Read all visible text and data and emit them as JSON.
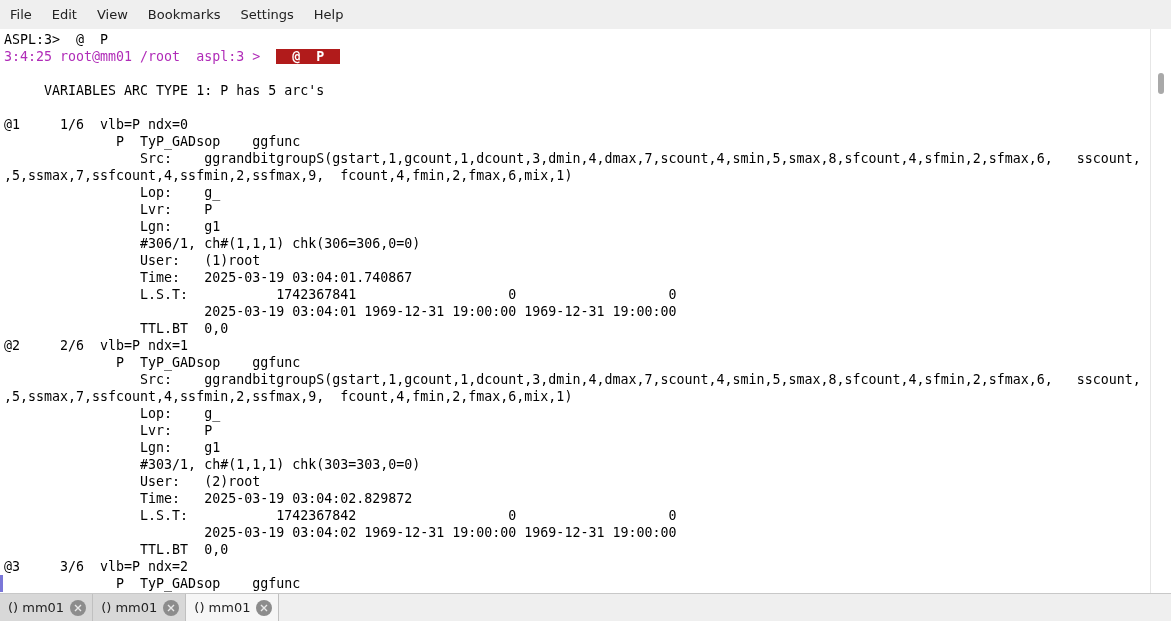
{
  "menu": [
    "File",
    "Edit",
    "View",
    "Bookmarks",
    "Settings",
    "Help"
  ],
  "terminal": {
    "first_line": "ASPL:3>  @  P",
    "prompt": {
      "text": "3:4:25 root@mm01 /root  aspl:3 >",
      "input": "@  P"
    },
    "headline": "     VARIABLES ARC TYPE 1: P has 5 arc's",
    "lines": [
      "@1     1/6  vlb=P ndx=0",
      "              P  TyP_GADsop    ggfunc",
      "                 Src:    ggrandbitgroupS(gstart,1,gcount,1,dcount,3,dmin,4,dmax,7,scount,4,smin,5,smax,8,sfcount,4,sfmin,2,sfmax,6,   sscount,",
      ",5,ssmax,7,ssfcount,4,ssfmin,2,ssfmax,9,  fcount,4,fmin,2,fmax,6,mix,1)",
      "                 Lop:    g_",
      "                 Lvr:    P",
      "                 Lgn:    g1",
      "                 #306/1, ch#(1,1,1) chk(306=306,0=0)",
      "                 User:   (1)root",
      "                 Time:   2025-03-19 03:04:01.740867",
      "                 L.S.T:           1742367841                   0                   0",
      "                         2025-03-19 03:04:01 1969-12-31 19:00:00 1969-12-31 19:00:00",
      "                 TTL.BT  0,0",
      "@2     2/6  vlb=P ndx=1",
      "              P  TyP_GADsop    ggfunc",
      "                 Src:    ggrandbitgroupS(gstart,1,gcount,1,dcount,3,dmin,4,dmax,7,scount,4,smin,5,smax,8,sfcount,4,sfmin,2,sfmax,6,   sscount,",
      ",5,ssmax,7,ssfcount,4,ssfmin,2,ssfmax,9,  fcount,4,fmin,2,fmax,6,mix,1)",
      "                 Lop:    g_",
      "                 Lvr:    P",
      "                 Lgn:    g1",
      "                 #303/1, ch#(1,1,1) chk(303=303,0=0)",
      "                 User:   (2)root",
      "                 Time:   2025-03-19 03:04:02.829872",
      "                 L.S.T:           1742367842                   0                   0",
      "                         2025-03-19 03:04:02 1969-12-31 19:00:00 1969-12-31 19:00:00",
      "                 TTL.BT  0,0",
      "@3     3/6  vlb=P ndx=2",
      "              P  TyP_GADsop    ggfunc"
    ]
  },
  "tabs": [
    {
      "label": "() mm01",
      "selected": false
    },
    {
      "label": "() mm01",
      "selected": false
    },
    {
      "label": "() mm01",
      "selected": true
    }
  ]
}
